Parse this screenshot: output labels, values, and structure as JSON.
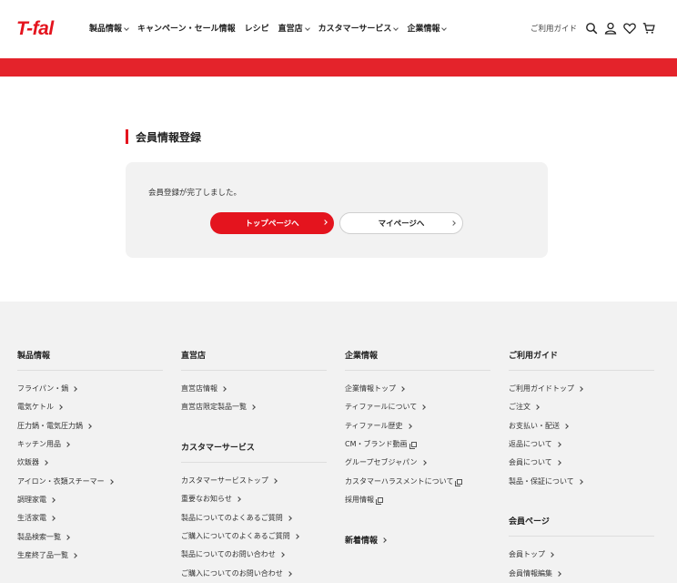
{
  "header": {
    "logo": "T-fal",
    "nav": [
      {
        "label": "製品情報",
        "has_dropdown": true
      },
      {
        "label": "キャンペーン・セール情報",
        "has_dropdown": false
      },
      {
        "label": "レシピ",
        "has_dropdown": false
      },
      {
        "label": "直営店",
        "has_dropdown": true
      },
      {
        "label": "カスタマーサービス",
        "has_dropdown": true
      },
      {
        "label": "企業情報",
        "has_dropdown": true
      }
    ],
    "guide_link": "ご利用ガイド",
    "icons": [
      "search-icon",
      "user-icon",
      "heart-icon",
      "cart-icon"
    ]
  },
  "main": {
    "title": "会員情報登録",
    "message": "会員登録が完了しました。",
    "btn_top": "トップページへ",
    "btn_mypage": "マイページへ"
  },
  "footer": {
    "col1": {
      "heading": "製品情報",
      "links": [
        "フライパン・鍋",
        "電気ケトル",
        "圧力鍋・電気圧力鍋",
        "キッチン用品",
        "炊飯器",
        "アイロン・衣類スチーマー",
        "調理家電",
        "生活家電",
        "製品検索一覧",
        "生産終了品一覧"
      ]
    },
    "col2": {
      "heading": "直営店",
      "links": [
        "直営店情報",
        "直営店限定製品一覧"
      ],
      "heading2": "カスタマーサービス",
      "links2": [
        "カスタマーサービストップ",
        "重要なお知らせ",
        "製品についてのよくあるご質問",
        "ご購入についてのよくあるご質問",
        "製品についてのお問い合わせ",
        "ご購入についてのお問い合わせ"
      ]
    },
    "col3": {
      "heading": "企業情報",
      "links": [
        "企業情報トップ",
        "ティファールについて",
        "ティファール歴史",
        "CM・ブランド動画",
        "グループセブジャパン",
        "カスタマーハラスメントについて",
        "採用情報"
      ],
      "heading2": "新着情報"
    },
    "col4": {
      "heading": "ご利用ガイド",
      "links": [
        "ご利用ガイドトップ",
        "ご注文",
        "お支払い・配送",
        "返品について",
        "会員について",
        "製品・保証について"
      ],
      "heading2": "会員ページ",
      "links2": [
        "会員トップ",
        "会員情報編集"
      ]
    }
  },
  "colors": {
    "brand_red": "#e4141e",
    "band_red": "#e4232b",
    "footer_bg": "#f2f2f2"
  }
}
